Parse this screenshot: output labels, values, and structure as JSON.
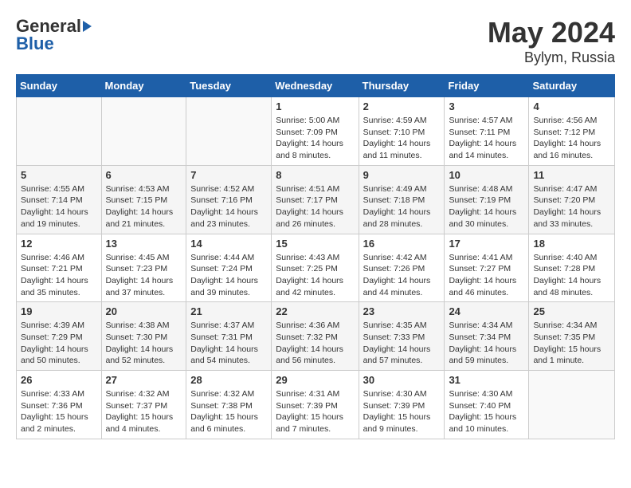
{
  "header": {
    "logo_general": "General",
    "logo_blue": "Blue",
    "month": "May 2024",
    "location": "Bylym, Russia"
  },
  "days_of_week": [
    "Sunday",
    "Monday",
    "Tuesday",
    "Wednesday",
    "Thursday",
    "Friday",
    "Saturday"
  ],
  "weeks": [
    [
      {
        "day": "",
        "info": ""
      },
      {
        "day": "",
        "info": ""
      },
      {
        "day": "",
        "info": ""
      },
      {
        "day": "1",
        "info": "Sunrise: 5:00 AM\nSunset: 7:09 PM\nDaylight: 14 hours\nand 8 minutes."
      },
      {
        "day": "2",
        "info": "Sunrise: 4:59 AM\nSunset: 7:10 PM\nDaylight: 14 hours\nand 11 minutes."
      },
      {
        "day": "3",
        "info": "Sunrise: 4:57 AM\nSunset: 7:11 PM\nDaylight: 14 hours\nand 14 minutes."
      },
      {
        "day": "4",
        "info": "Sunrise: 4:56 AM\nSunset: 7:12 PM\nDaylight: 14 hours\nand 16 minutes."
      }
    ],
    [
      {
        "day": "5",
        "info": "Sunrise: 4:55 AM\nSunset: 7:14 PM\nDaylight: 14 hours\nand 19 minutes."
      },
      {
        "day": "6",
        "info": "Sunrise: 4:53 AM\nSunset: 7:15 PM\nDaylight: 14 hours\nand 21 minutes."
      },
      {
        "day": "7",
        "info": "Sunrise: 4:52 AM\nSunset: 7:16 PM\nDaylight: 14 hours\nand 23 minutes."
      },
      {
        "day": "8",
        "info": "Sunrise: 4:51 AM\nSunset: 7:17 PM\nDaylight: 14 hours\nand 26 minutes."
      },
      {
        "day": "9",
        "info": "Sunrise: 4:49 AM\nSunset: 7:18 PM\nDaylight: 14 hours\nand 28 minutes."
      },
      {
        "day": "10",
        "info": "Sunrise: 4:48 AM\nSunset: 7:19 PM\nDaylight: 14 hours\nand 30 minutes."
      },
      {
        "day": "11",
        "info": "Sunrise: 4:47 AM\nSunset: 7:20 PM\nDaylight: 14 hours\nand 33 minutes."
      }
    ],
    [
      {
        "day": "12",
        "info": "Sunrise: 4:46 AM\nSunset: 7:21 PM\nDaylight: 14 hours\nand 35 minutes."
      },
      {
        "day": "13",
        "info": "Sunrise: 4:45 AM\nSunset: 7:23 PM\nDaylight: 14 hours\nand 37 minutes."
      },
      {
        "day": "14",
        "info": "Sunrise: 4:44 AM\nSunset: 7:24 PM\nDaylight: 14 hours\nand 39 minutes."
      },
      {
        "day": "15",
        "info": "Sunrise: 4:43 AM\nSunset: 7:25 PM\nDaylight: 14 hours\nand 42 minutes."
      },
      {
        "day": "16",
        "info": "Sunrise: 4:42 AM\nSunset: 7:26 PM\nDaylight: 14 hours\nand 44 minutes."
      },
      {
        "day": "17",
        "info": "Sunrise: 4:41 AM\nSunset: 7:27 PM\nDaylight: 14 hours\nand 46 minutes."
      },
      {
        "day": "18",
        "info": "Sunrise: 4:40 AM\nSunset: 7:28 PM\nDaylight: 14 hours\nand 48 minutes."
      }
    ],
    [
      {
        "day": "19",
        "info": "Sunrise: 4:39 AM\nSunset: 7:29 PM\nDaylight: 14 hours\nand 50 minutes."
      },
      {
        "day": "20",
        "info": "Sunrise: 4:38 AM\nSunset: 7:30 PM\nDaylight: 14 hours\nand 52 minutes."
      },
      {
        "day": "21",
        "info": "Sunrise: 4:37 AM\nSunset: 7:31 PM\nDaylight: 14 hours\nand 54 minutes."
      },
      {
        "day": "22",
        "info": "Sunrise: 4:36 AM\nSunset: 7:32 PM\nDaylight: 14 hours\nand 56 minutes."
      },
      {
        "day": "23",
        "info": "Sunrise: 4:35 AM\nSunset: 7:33 PM\nDaylight: 14 hours\nand 57 minutes."
      },
      {
        "day": "24",
        "info": "Sunrise: 4:34 AM\nSunset: 7:34 PM\nDaylight: 14 hours\nand 59 minutes."
      },
      {
        "day": "25",
        "info": "Sunrise: 4:34 AM\nSunset: 7:35 PM\nDaylight: 15 hours\nand 1 minute."
      }
    ],
    [
      {
        "day": "26",
        "info": "Sunrise: 4:33 AM\nSunset: 7:36 PM\nDaylight: 15 hours\nand 2 minutes."
      },
      {
        "day": "27",
        "info": "Sunrise: 4:32 AM\nSunset: 7:37 PM\nDaylight: 15 hours\nand 4 minutes."
      },
      {
        "day": "28",
        "info": "Sunrise: 4:32 AM\nSunset: 7:38 PM\nDaylight: 15 hours\nand 6 minutes."
      },
      {
        "day": "29",
        "info": "Sunrise: 4:31 AM\nSunset: 7:39 PM\nDaylight: 15 hours\nand 7 minutes."
      },
      {
        "day": "30",
        "info": "Sunrise: 4:30 AM\nSunset: 7:39 PM\nDaylight: 15 hours\nand 9 minutes."
      },
      {
        "day": "31",
        "info": "Sunrise: 4:30 AM\nSunset: 7:40 PM\nDaylight: 15 hours\nand 10 minutes."
      },
      {
        "day": "",
        "info": ""
      }
    ]
  ]
}
